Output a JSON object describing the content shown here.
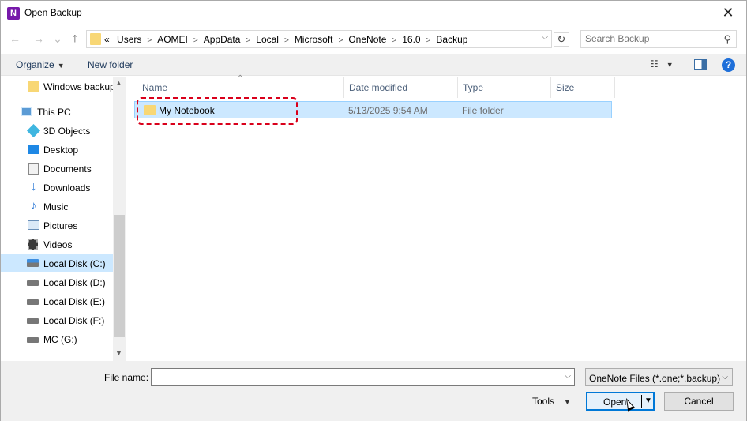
{
  "window": {
    "title": "Open Backup",
    "app_icon_letter": "N",
    "close_glyph": "✕"
  },
  "nav_buttons": {
    "back": "←",
    "forward": "→",
    "recent": "⌄",
    "up": "↑"
  },
  "address": {
    "overflow": "«",
    "crumbs": [
      "Users",
      "AppData",
      "Local",
      "Microsoft",
      "OneNote",
      "16.0",
      "Backup"
    ],
    "crumb_user": "AOMEI",
    "refresh_glyph": "↻"
  },
  "search": {
    "placeholder": "Search Backup"
  },
  "toolbar": {
    "organize_label": "Organize",
    "new_folder_label": "New folder",
    "help_glyph": "?"
  },
  "nav_pane": {
    "items": [
      {
        "label": "Windows backup",
        "icon": "folder-icon"
      },
      {
        "label": "This PC",
        "icon": "pc-icon"
      },
      {
        "label": "3D Objects",
        "icon": "3d-objects-icon"
      },
      {
        "label": "Desktop",
        "icon": "desktop-icon"
      },
      {
        "label": "Documents",
        "icon": "documents-icon"
      },
      {
        "label": "Downloads",
        "icon": "downloads-icon"
      },
      {
        "label": "Music",
        "icon": "music-icon"
      },
      {
        "label": "Pictures",
        "icon": "pictures-icon"
      },
      {
        "label": "Videos",
        "icon": "videos-icon"
      },
      {
        "label": "Local Disk (C:)",
        "icon": "drive-icon",
        "selected": true
      },
      {
        "label": "Local Disk (D:)",
        "icon": "drive-icon"
      },
      {
        "label": "Local Disk (E:)",
        "icon": "drive-icon"
      },
      {
        "label": "Local Disk (F:)",
        "icon": "drive-icon"
      },
      {
        "label": "MC (G:)",
        "icon": "drive-icon"
      }
    ]
  },
  "file_list": {
    "columns": [
      "Name",
      "Date modified",
      "Type",
      "Size"
    ],
    "rows": [
      {
        "name": "My Notebook",
        "date_modified": "5/13/2025 9:54 AM",
        "type": "File folder",
        "size": ""
      }
    ]
  },
  "footer": {
    "file_name_label": "File name:",
    "file_name_value": "",
    "file_type": "OneNote Files (*.one;*.backup)",
    "tools_label": "Tools",
    "open_label": "Open",
    "cancel_label": "Cancel"
  },
  "colors": {
    "selection": "#cce8ff",
    "highlight_border": "#d9001b",
    "folder": "#f8d775",
    "accent": "#0078d7"
  }
}
